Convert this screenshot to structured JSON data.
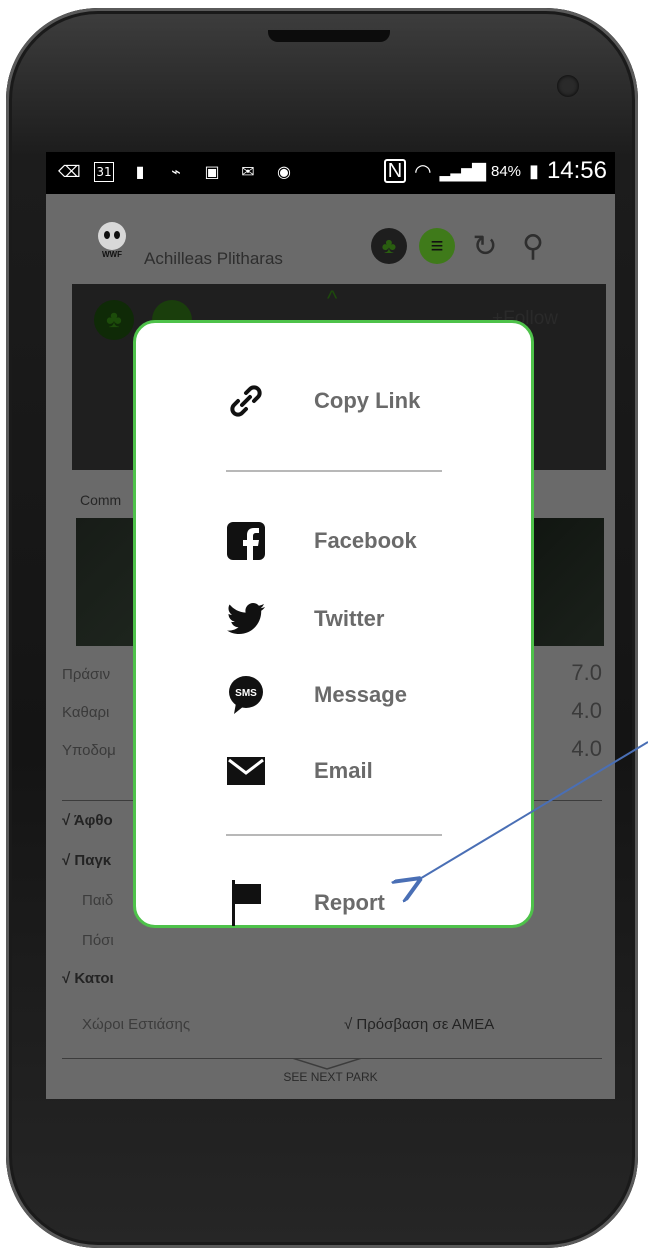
{
  "status_bar": {
    "battery_percent": "84%",
    "time": "14:56",
    "calendar_day": "31",
    "left_icons": [
      "back-icon",
      "calendar-icon",
      "battery-charge-icon",
      "leaf-icon",
      "chat-icon",
      "mail-icon",
      "shazam-icon"
    ],
    "right_icons": [
      "nfc-icon",
      "wifi-icon",
      "signal-icon",
      "battery-icon"
    ]
  },
  "header": {
    "logo_text": "WWF",
    "username": "Achilleas Plitharas",
    "icons": [
      "tree-icon",
      "menu-icon",
      "refresh-icon",
      "search-icon"
    ]
  },
  "background": {
    "follow_label": "+Follow",
    "comments_label": "Comm",
    "ratings": [
      {
        "label": "Πράσιν",
        "value": "7.0"
      },
      {
        "label": "Καθαρι",
        "value": "4.0"
      },
      {
        "label": "Υποδομ",
        "value": "4.0"
      }
    ],
    "features": [
      {
        "text": "√ Άφθο",
        "style": "bold"
      },
      {
        "text": "√ Παγκ",
        "style": "bold"
      },
      {
        "text": "Παιδ",
        "style": "dim"
      },
      {
        "text": "Πόσι",
        "style": "dim"
      },
      {
        "text": "√ Κατοι",
        "style": "bold"
      }
    ],
    "bottom_left": "Χώροι Εστιάσης",
    "bottom_right": "√ Πρόσβαση σε ΑΜΕΑ",
    "next_label": "SEE NEXT PARK"
  },
  "share_menu": {
    "accent_color": "#4ec24a",
    "items": [
      {
        "label": "Copy Link",
        "icon": "link-icon"
      },
      {
        "label": "Facebook",
        "icon": "facebook-icon"
      },
      {
        "label": "Twitter",
        "icon": "twitter-icon"
      },
      {
        "label": "Message",
        "icon": "sms-icon"
      },
      {
        "label": "Email",
        "icon": "email-icon"
      },
      {
        "label": "Report",
        "icon": "flag-icon"
      }
    ],
    "sms_badge": "SMS"
  },
  "annotation": {
    "color": "#4a6fb5"
  }
}
